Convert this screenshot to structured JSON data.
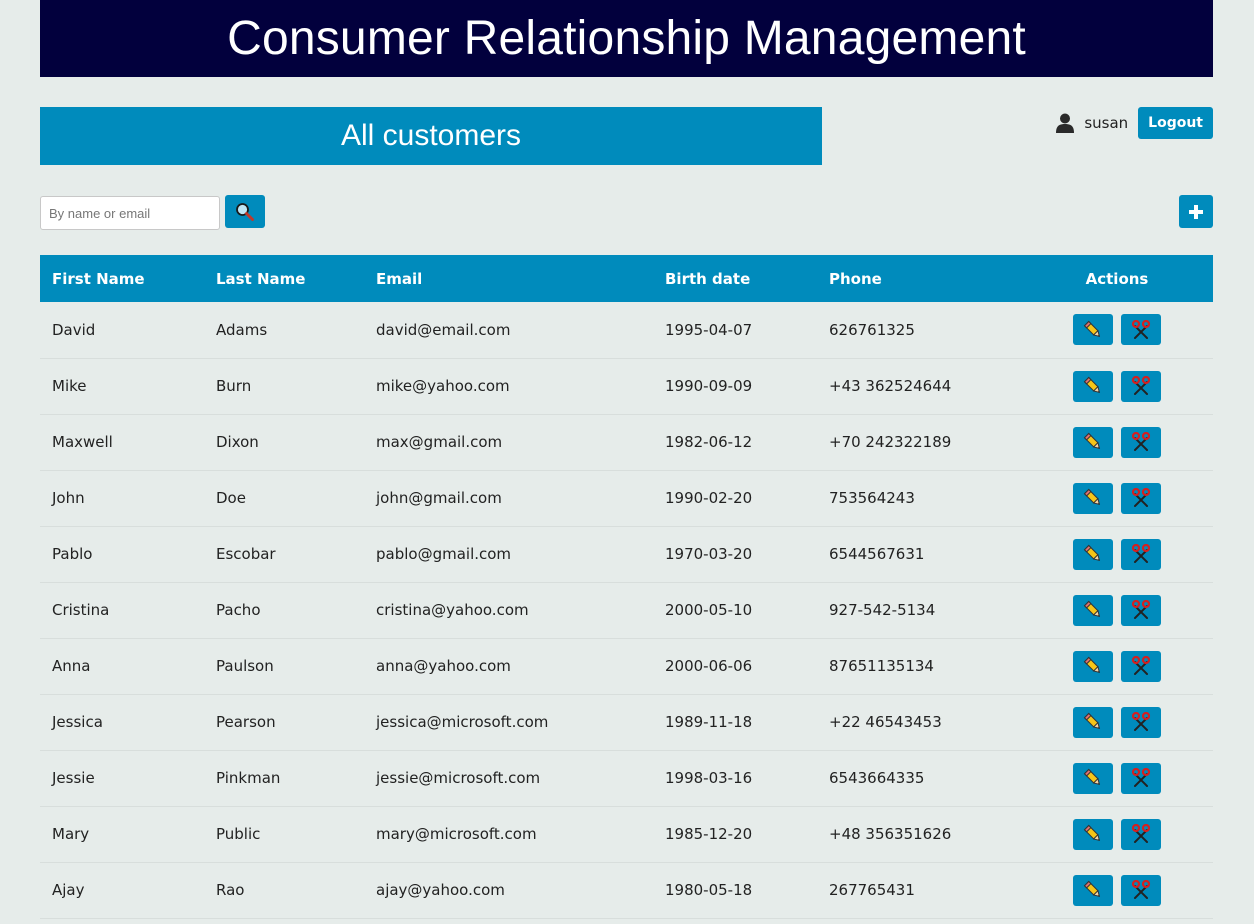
{
  "header": {
    "title": "Consumer Relationship Management"
  },
  "section": {
    "title": "All customers"
  },
  "user": {
    "name": "susan",
    "logout_label": "Logout"
  },
  "search": {
    "placeholder": "By name or email",
    "value": ""
  },
  "icons": {
    "user": "user-icon",
    "search": "magnifier-icon",
    "add": "plus-icon",
    "edit": "pencil-icon",
    "delete": "scissors-icon"
  },
  "colors": {
    "banner": "#02003d",
    "accent": "#008bbc",
    "background": "#e6ecea"
  },
  "table": {
    "columns": [
      "First Name",
      "Last Name",
      "Email",
      "Birth date",
      "Phone",
      "Actions"
    ],
    "rows": [
      [
        "David",
        "Adams",
        "david@email.com",
        "1995-04-07",
        "626761325"
      ],
      [
        "Mike",
        "Burn",
        "mike@yahoo.com",
        "1990-09-09",
        "+43 362524644"
      ],
      [
        "Maxwell",
        "Dixon",
        "max@gmail.com",
        "1982-06-12",
        "+70 242322189"
      ],
      [
        "John",
        "Doe",
        "john@gmail.com",
        "1990-02-20",
        "753564243"
      ],
      [
        "Pablo",
        "Escobar",
        "pablo@gmail.com",
        "1970-03-20",
        "6544567631"
      ],
      [
        "Cristina",
        "Pacho",
        "cristina@yahoo.com",
        "2000-05-10",
        "927-542-5134"
      ],
      [
        "Anna",
        "Paulson",
        "anna@yahoo.com",
        "2000-06-06",
        "87651135134"
      ],
      [
        "Jessica",
        "Pearson",
        "jessica@microsoft.com",
        "1989-11-18",
        "+22 46543453"
      ],
      [
        "Jessie",
        "Pinkman",
        "jessie@microsoft.com",
        "1998-03-16",
        "6543664335"
      ],
      [
        "Mary",
        "Public",
        "mary@microsoft.com",
        "1985-12-20",
        "+48 356351626"
      ],
      [
        "Ajay",
        "Rao",
        "ajay@yahoo.com",
        "1980-05-18",
        "267765431"
      ]
    ]
  }
}
